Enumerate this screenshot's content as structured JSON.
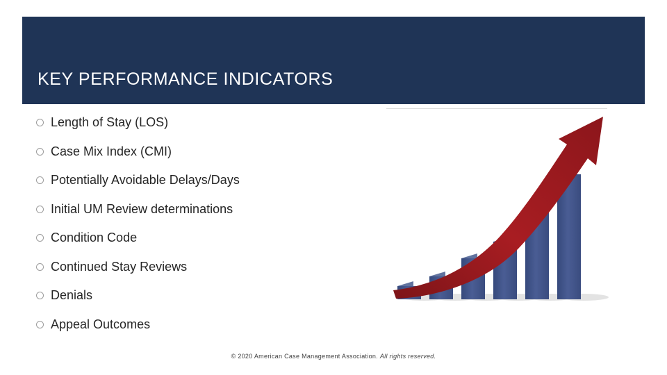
{
  "header": {
    "title": "KEY PERFORMANCE INDICATORS",
    "band_color": "#1f3456",
    "rule_dark_color": "#17253f",
    "rule_blue_color": "#2e75b6",
    "rule_gray_color": "#a6a6a6"
  },
  "bullets": [
    {
      "label": "Length of Stay  (LOS)"
    },
    {
      "label": "Case Mix Index  (CMI)"
    },
    {
      "label": "Potentially Avoidable Delays/Days"
    },
    {
      "label": "Initial UM Review determinations"
    },
    {
      "label": "Condition Code"
    },
    {
      "label": "Continued Stay Reviews"
    },
    {
      "label": "Denials"
    },
    {
      "label": "Appeal Outcomes"
    }
  ],
  "graphic": {
    "name": "growth-bar-chart-with-rising-arrow",
    "bar_color": "#41558e",
    "bar_side_color": "#2f3f6e",
    "bar_top_color": "#61739f",
    "arrow_color": "#9e1b20",
    "bar_count": 6
  },
  "footer": {
    "copyright": "© 2020 American Case Management Association.",
    "rights": "All rights reserved."
  }
}
